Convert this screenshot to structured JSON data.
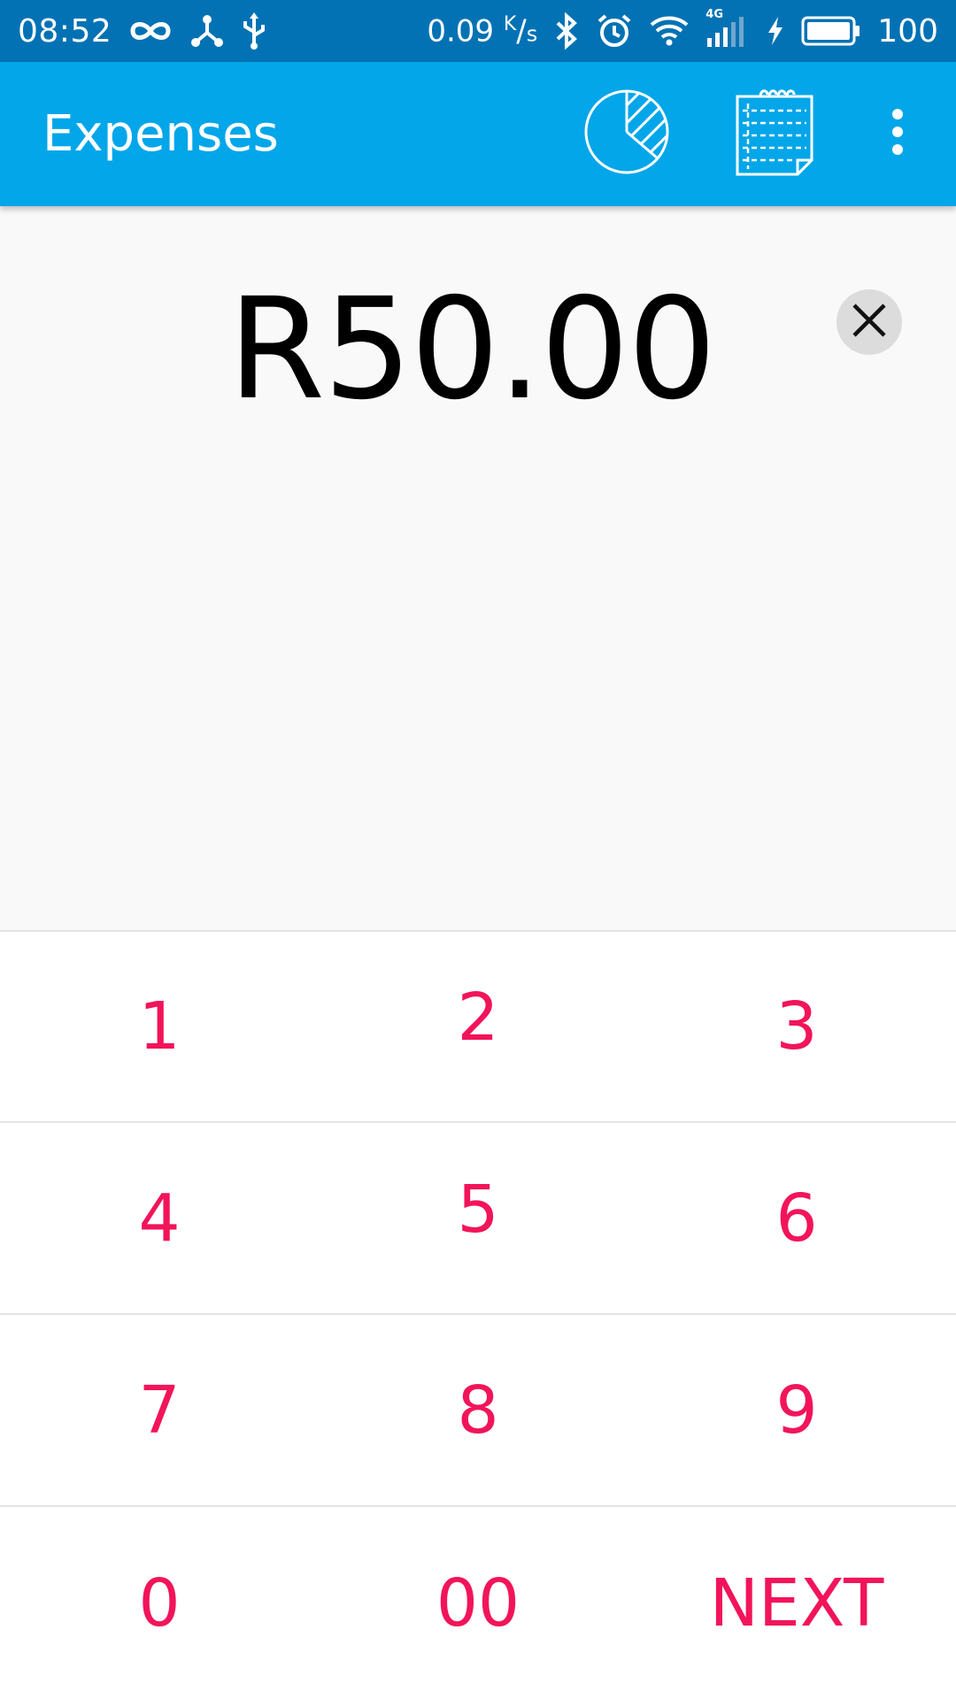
{
  "status_bar": {
    "time": "08:52",
    "net_speed_value": "0.09",
    "net_speed_unit_top": "K",
    "net_speed_unit_bottom": "s",
    "network_type": "4G",
    "battery_level": "100",
    "icons": [
      "infinity-icon",
      "share-hub-icon",
      "usb-icon",
      "bluetooth-icon",
      "alarm-icon",
      "wifi-icon",
      "signal-icon",
      "charging-icon",
      "battery-icon"
    ]
  },
  "app_bar": {
    "title": "Expenses",
    "icons": [
      "pie-chart-icon",
      "notepad-icon",
      "more-vert-icon"
    ]
  },
  "amount": {
    "value": "R50.00"
  },
  "keypad": {
    "rows": [
      [
        "1",
        "2",
        "3"
      ],
      [
        "4",
        "5",
        "6"
      ],
      [
        "7",
        "8",
        "9"
      ],
      [
        "0",
        "00",
        "NEXT"
      ]
    ]
  },
  "colors": {
    "status_bar": "#0372b4",
    "app_bar": "#03a6e9",
    "accent": "#f2145a",
    "background": "#f9f9f9",
    "keypad_background": "#ffffff"
  }
}
